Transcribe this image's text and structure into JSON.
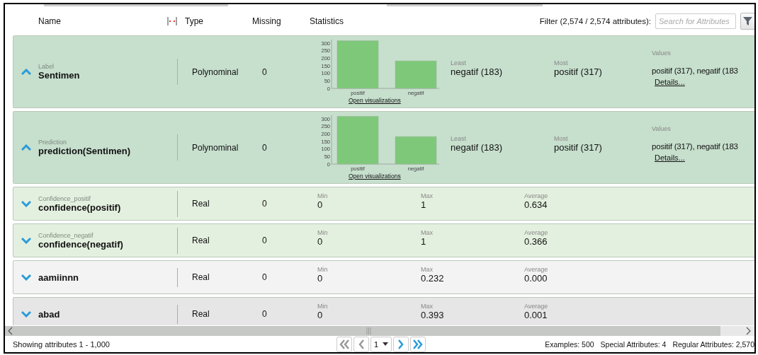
{
  "header": {
    "columns": [
      "Name",
      "Type",
      "Missing",
      "Statistics"
    ],
    "filter_label": "Filter (2,574 / 2,574 attributes):",
    "search": {
      "placeholder": "Search for Attributes"
    }
  },
  "rows": [
    {
      "role": "Label",
      "name": "Sentimen",
      "expanded": true,
      "color": "#c7dfcd",
      "type": "Polynominal",
      "missing": "0",
      "kind": "nominal",
      "chart_data": {
        "type": "bar",
        "categories": [
          "positif",
          "negatif"
        ],
        "values": [
          317,
          183
        ],
        "yticks": [
          0,
          50,
          100,
          150,
          200,
          250,
          300
        ],
        "ylim": [
          0,
          320
        ]
      },
      "link": "Open visualizations",
      "stats": [
        {
          "label": "Least",
          "value": "negatif (183)"
        },
        {
          "label": "Most",
          "value": "positif (317)"
        },
        {
          "label": "Values",
          "value": "positif (317), negatif (183",
          "link": "Details..."
        }
      ]
    },
    {
      "role": "Prediction",
      "name": "prediction(Sentimen)",
      "expanded": true,
      "color": "#c7dfcd",
      "type": "Polynominal",
      "missing": "0",
      "kind": "nominal",
      "chart_data": {
        "type": "bar",
        "categories": [
          "positif",
          "negatif"
        ],
        "values": [
          317,
          183
        ],
        "yticks": [
          0,
          50,
          100,
          150,
          200,
          250,
          300
        ],
        "ylim": [
          0,
          320
        ]
      },
      "link": "Open visualizations",
      "stats": [
        {
          "label": "Least",
          "value": "negatif (183)"
        },
        {
          "label": "Most",
          "value": "positif (317)"
        },
        {
          "label": "Values",
          "value": "positif (317), negatif (183",
          "link": "Details..."
        }
      ]
    },
    {
      "role": "Confidence_positif",
      "name": "confidence(positif)",
      "expanded": false,
      "color": "#e4f0df",
      "type": "Real",
      "missing": "0",
      "kind": "numeric",
      "stats": [
        {
          "label": "Min",
          "value": "0"
        },
        {
          "label": "Max",
          "value": "1"
        },
        {
          "label": "Average",
          "value": "0.634"
        }
      ]
    },
    {
      "role": "Confidence_negatif",
      "name": "confidence(negatif)",
      "expanded": false,
      "color": "#e4f0df",
      "type": "Real",
      "missing": "0",
      "kind": "numeric",
      "stats": [
        {
          "label": "Min",
          "value": "0"
        },
        {
          "label": "Max",
          "value": "1"
        },
        {
          "label": "Average",
          "value": "0.366"
        }
      ]
    },
    {
      "name": "aamiinnn",
      "expanded": false,
      "color": "#f3f3f3",
      "type": "Real",
      "missing": "0",
      "kind": "numeric",
      "stats": [
        {
          "label": "Min",
          "value": "0"
        },
        {
          "label": "Max",
          "value": "0.232"
        },
        {
          "label": "Average",
          "value": "0.000"
        }
      ]
    },
    {
      "name": "abad",
      "expanded": false,
      "color": "#e6e6e6",
      "type": "Real",
      "missing": "0",
      "kind": "numeric",
      "stats": [
        {
          "label": "Min",
          "value": "0"
        },
        {
          "label": "Max",
          "value": "0.393"
        },
        {
          "label": "Average",
          "value": "0.001"
        }
      ]
    }
  ],
  "footer": {
    "showing": "Showing attributes 1 - 1,000",
    "page": "1",
    "summary": [
      "Examples: 500",
      "Special Attributes: 4",
      "Regular Attributes: 2,570"
    ]
  }
}
